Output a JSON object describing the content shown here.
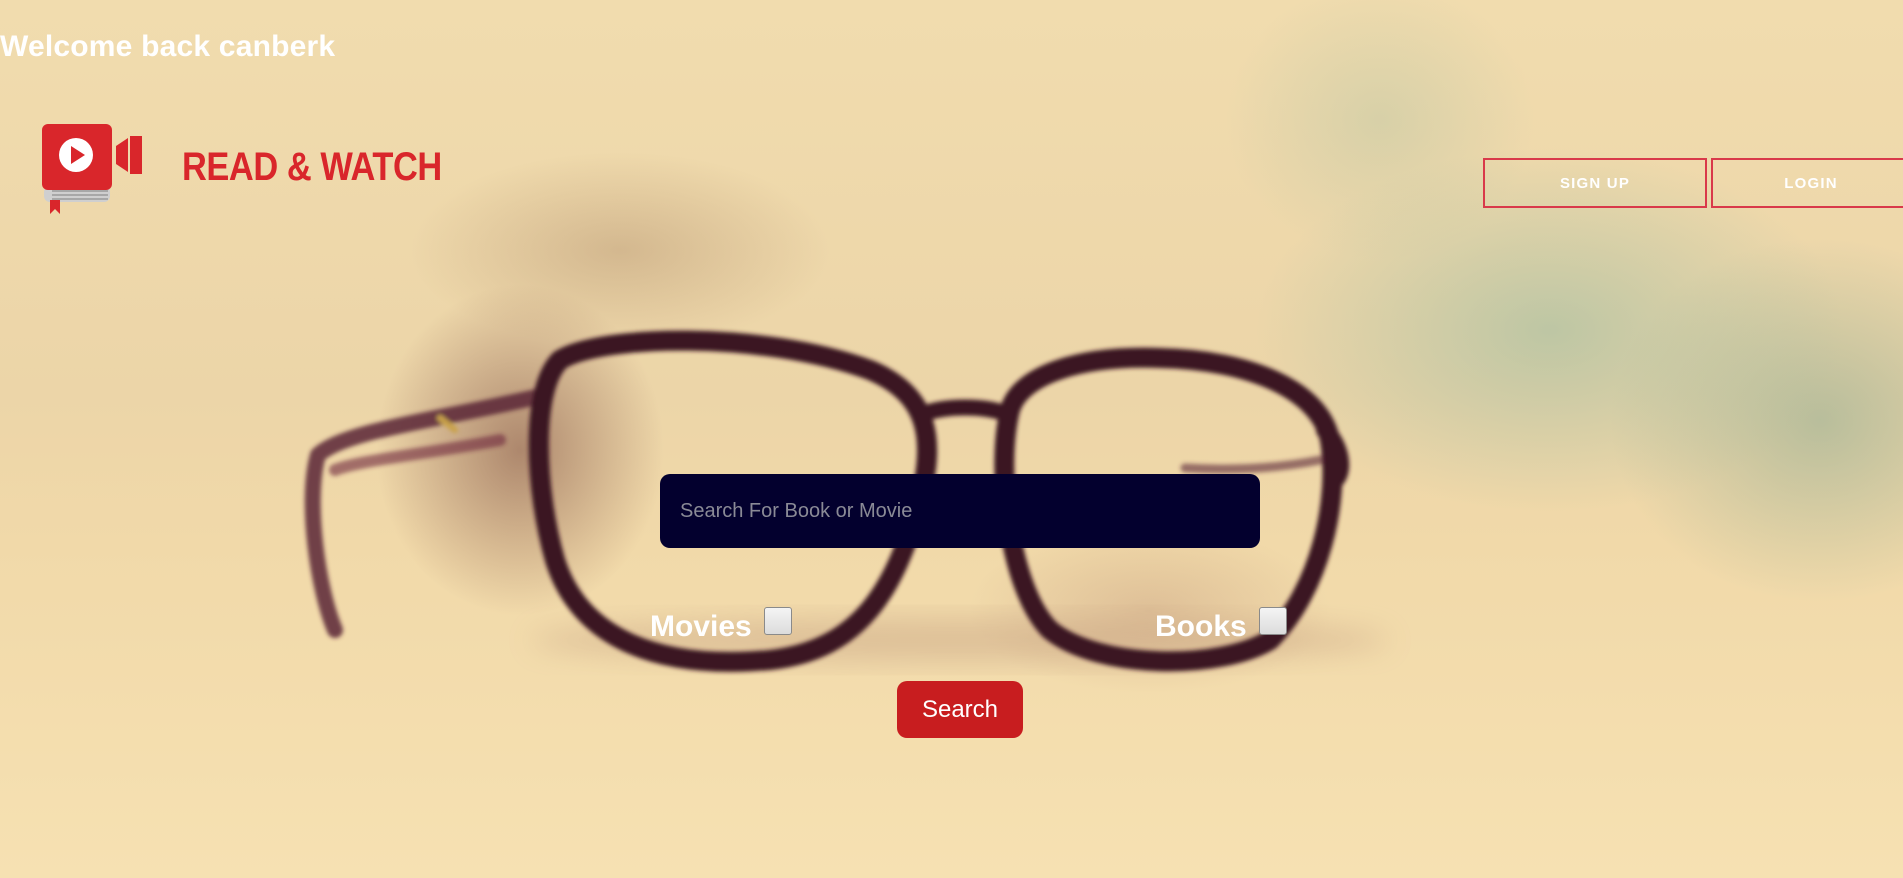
{
  "header": {
    "welcome_text": "Welcome back canberk"
  },
  "brand": {
    "name": "READ & WATCH",
    "icon": "book-video-camera-logo",
    "color": "#d9262b"
  },
  "nav": {
    "signup_label": "SIGN UP",
    "login_label": "LOGIN",
    "border_color": "#d9394a"
  },
  "search": {
    "placeholder": "Search For Book or Movie",
    "value": "",
    "button_label": "Search",
    "button_color": "#c81d1f",
    "input_background": "#03002e"
  },
  "filters": {
    "movies_label": "Movies",
    "movies_checked": false,
    "books_label": "Books",
    "books_checked": false
  }
}
